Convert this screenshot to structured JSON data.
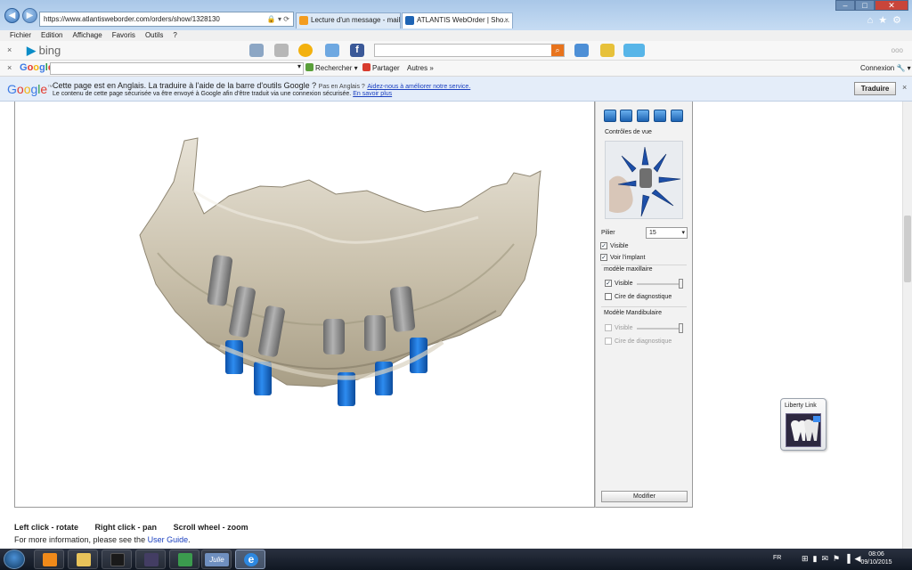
{
  "browser": {
    "address": "https://www.atlantisweborder.com/orders/show/1328130",
    "address_host": "atlantisweborder.com",
    "tabs": [
      {
        "label": "Lecture d'un message - mail O..."
      },
      {
        "label": "ATLANTIS WebOrder | Sho..."
      }
    ],
    "window_controls": {
      "minimize": "–",
      "maximize": "□",
      "close": "✕"
    }
  },
  "menubar": {
    "items": [
      "Fichier",
      "Edition",
      "Affichage",
      "Favoris",
      "Outils",
      "?"
    ]
  },
  "bingbar": {
    "close": "×",
    "logo": "bing",
    "more": "ooo"
  },
  "googlebar": {
    "close": "×",
    "logo": "Google",
    "search_label": "Rechercher",
    "share_label": "Partager",
    "more_label": "Autres »",
    "signin_label": "Connexion"
  },
  "translatebar": {
    "logo": "Google",
    "message": "Cette page est en Anglais. La traduire à l'aide de la barre d'outils Google ?",
    "not_english": "Pas en Anglais ?",
    "help_link": "Aidez-nous à améliorer notre service.",
    "secure_note": "Le contenu de cette page sécurisée va être envoyé à Google afin d'être traduit via une connexion sécurisée.",
    "learn_more": "En savoir plus",
    "translate_button": "Traduire",
    "close": "×"
  },
  "panel": {
    "view_controls_title": "Contrôles de vue",
    "pilier_label": "Pilier",
    "pilier_value": "15",
    "visible_label": "Visible",
    "visible_checked": true,
    "voir_implant_label": "Voir l'implant",
    "voir_implant_checked": true,
    "modele_maxillaire_title": "modèle maxillaire",
    "maxillaire_visible_label": "Visible",
    "maxillaire_visible_checked": true,
    "maxillaire_cire_label": "Cire de diagnostique",
    "maxillaire_cire_checked": false,
    "modele_mandibulaire_title": "Modèle Mandibulaire",
    "mandibulaire_visible_label": "Visible",
    "mandibulaire_visible_checked": false,
    "mandibulaire_cire_label": "Cire de diagnostique",
    "mandibulaire_cire_checked": false,
    "modifier_button": "Modifier"
  },
  "instructions": {
    "left_click": "Left click - rotate",
    "right_click": "Right click - pan",
    "scroll": "Scroll wheel - zoom",
    "more_info": "For more information, please see the",
    "user_guide_link": "User Guide",
    "period": "."
  },
  "liberty_link": {
    "title": "Liberty Link"
  },
  "taskbar": {
    "language": "FR",
    "time": "08:06",
    "date": "09/10/2015",
    "julie_label": "Julie"
  },
  "colors": {
    "model_bone": "#c8c0ad",
    "abutment_gray": "#8a8a8a",
    "implant_blue": "#1a7ad6",
    "brand_blue": "#1a3fbf"
  }
}
